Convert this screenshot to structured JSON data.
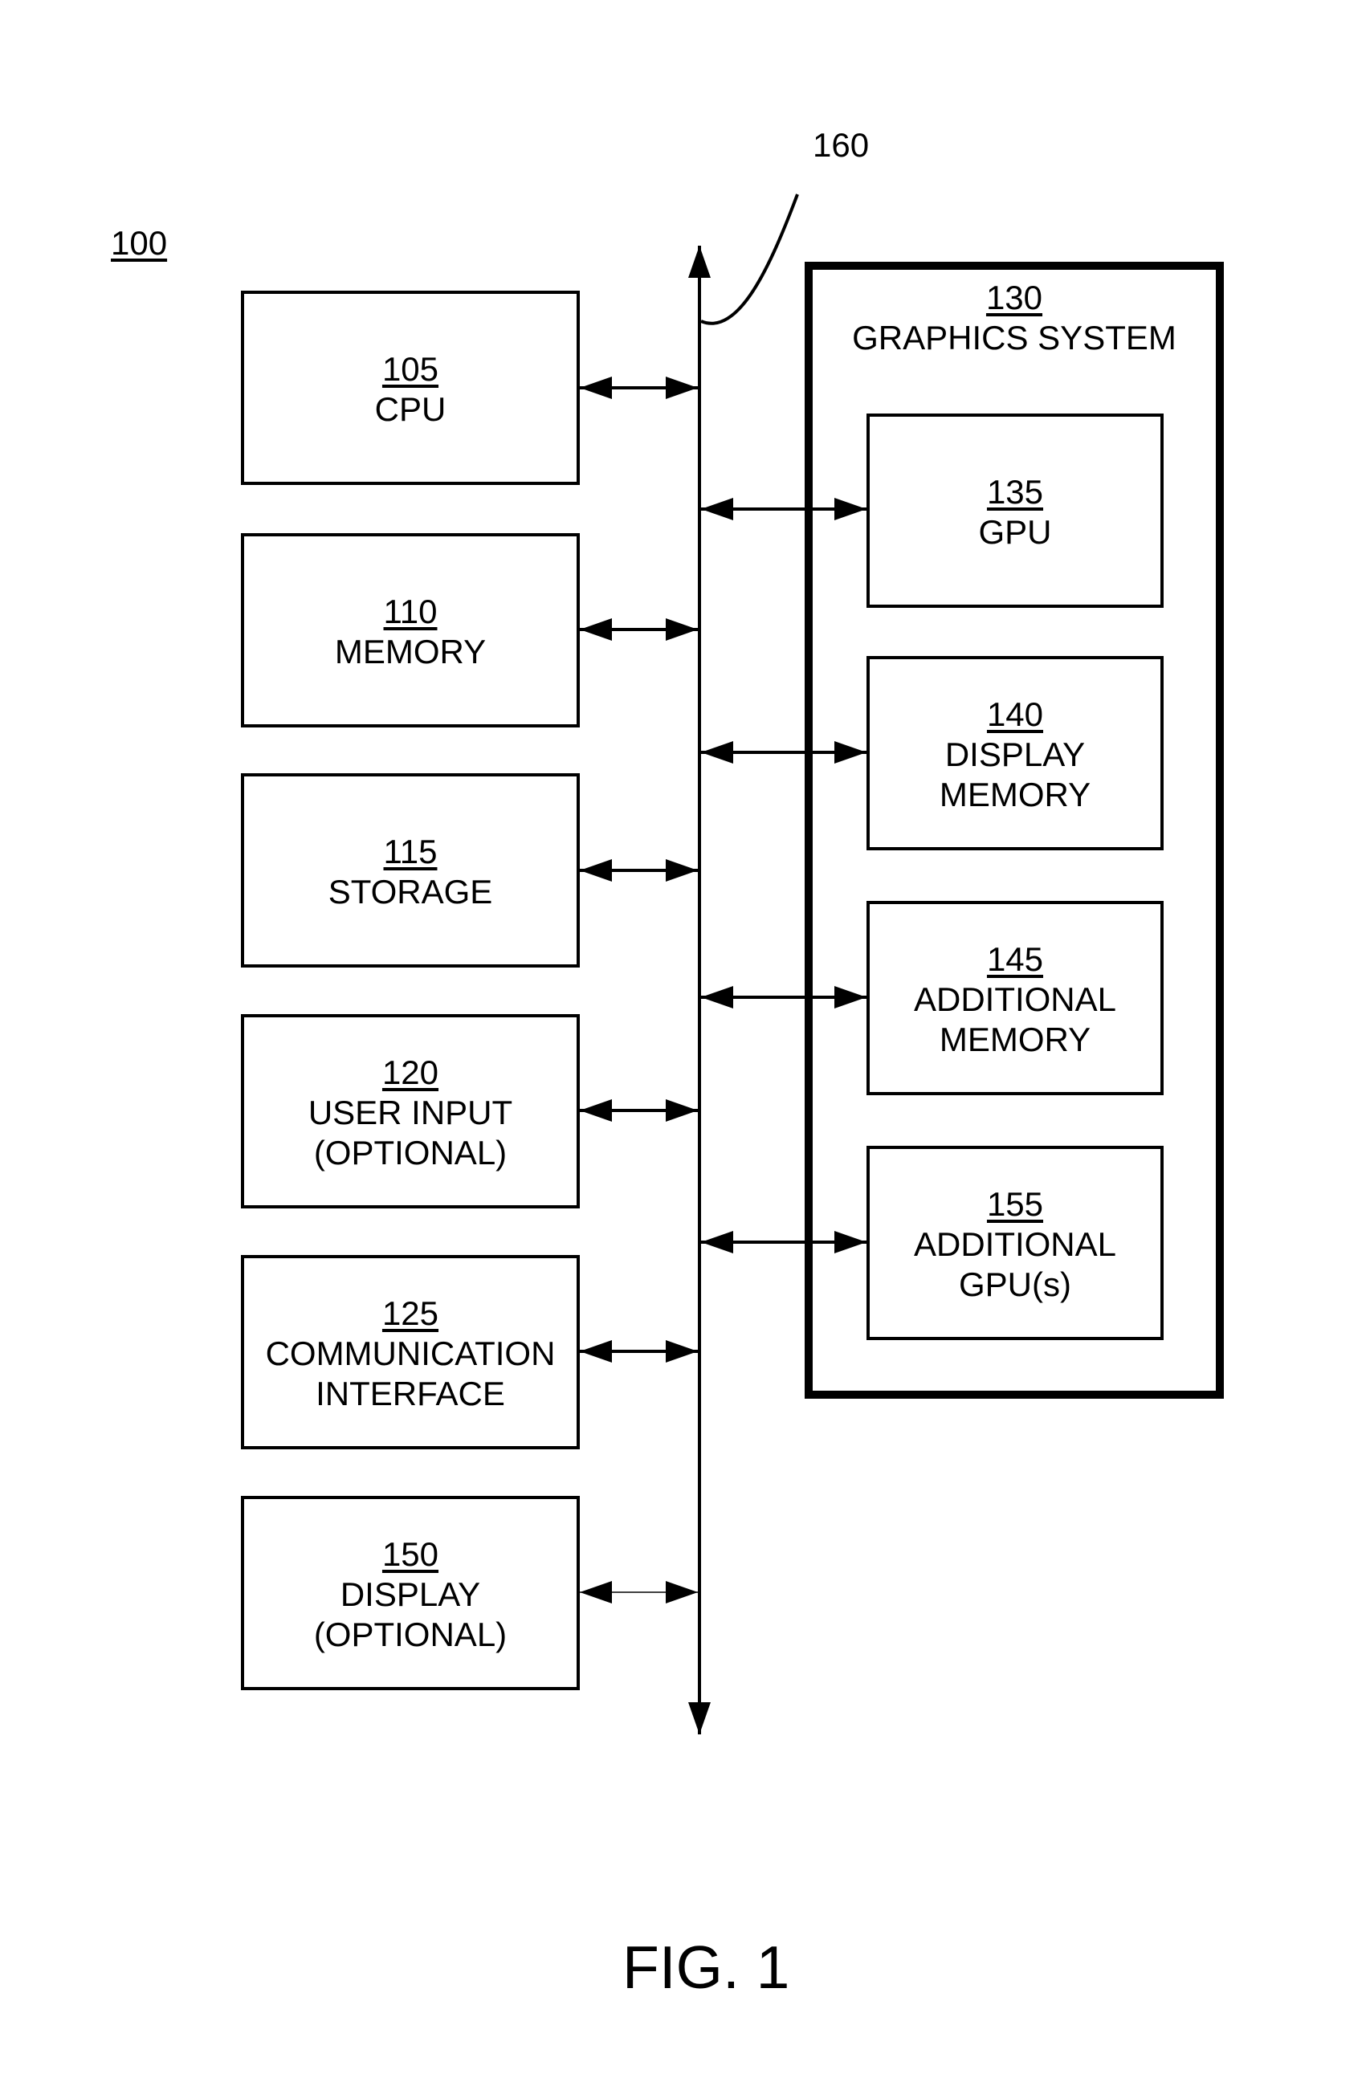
{
  "figure": {
    "system_ref": "100",
    "bus_ref": "160",
    "caption": "FIG. 1"
  },
  "left_components": [
    {
      "ref": "105",
      "lines": [
        "CPU"
      ]
    },
    {
      "ref": "110",
      "lines": [
        "MEMORY"
      ]
    },
    {
      "ref": "115",
      "lines": [
        "STORAGE"
      ]
    },
    {
      "ref": "120",
      "lines": [
        "USER INPUT",
        "(OPTIONAL)"
      ]
    },
    {
      "ref": "125",
      "lines": [
        "COMMUNICATION",
        "INTERFACE"
      ]
    },
    {
      "ref": "150",
      "lines": [
        "DISPLAY",
        "(OPTIONAL)"
      ]
    }
  ],
  "graphics_system": {
    "ref": "130",
    "title": "GRAPHICS SYSTEM",
    "components": [
      {
        "ref": "135",
        "lines": [
          "GPU"
        ]
      },
      {
        "ref": "140",
        "lines": [
          "DISPLAY",
          "MEMORY"
        ]
      },
      {
        "ref": "145",
        "lines": [
          "ADDITIONAL",
          "MEMORY"
        ]
      },
      {
        "ref": "155",
        "lines": [
          "ADDITIONAL",
          "GPU(s)"
        ]
      }
    ]
  },
  "connections": [
    {
      "from": "105",
      "to": "160",
      "type": "bidirectional"
    },
    {
      "from": "110",
      "to": "160",
      "type": "bidirectional"
    },
    {
      "from": "115",
      "to": "160",
      "type": "bidirectional"
    },
    {
      "from": "120",
      "to": "160",
      "type": "bidirectional"
    },
    {
      "from": "125",
      "to": "160",
      "type": "bidirectional"
    },
    {
      "from": "150",
      "to": "160",
      "type": "bidirectional"
    },
    {
      "from": "160",
      "to": "135",
      "type": "bidirectional"
    },
    {
      "from": "160",
      "to": "140",
      "type": "bidirectional"
    },
    {
      "from": "160",
      "to": "145",
      "type": "bidirectional"
    },
    {
      "from": "160",
      "to": "155",
      "type": "bidirectional"
    }
  ]
}
